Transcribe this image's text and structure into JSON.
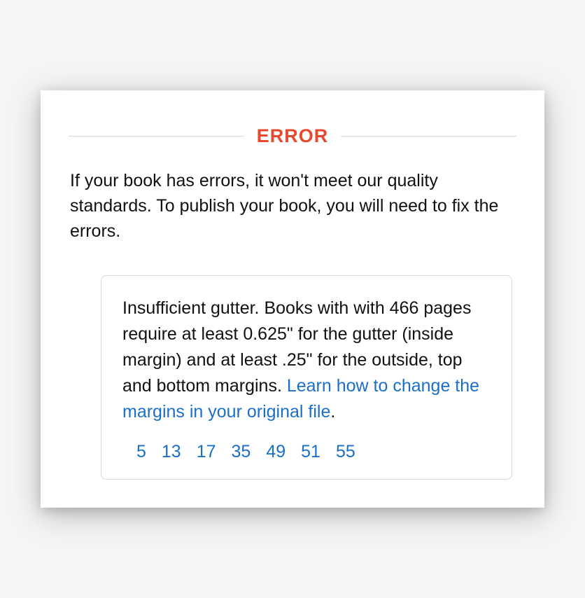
{
  "header": {
    "title": "ERROR"
  },
  "intro": "If your book has errors, it won't meet our quality standards. To publish your book, you will need to fix the errors.",
  "error_box": {
    "message": "Insufficient gutter. Books with with 466 pages require at least 0.625\" for the gutter (inside margin) and at least .25\" for the outside, top and bottom margins. ",
    "link_text": "Learn how to change the margins in your original file",
    "period": ".",
    "pages": [
      "5",
      "13",
      "17",
      "35",
      "49",
      "51",
      "55"
    ]
  },
  "colors": {
    "error_red": "#e7492e",
    "link_blue": "#1b6fc8",
    "border_gray": "#d5d9d9",
    "text_black": "#111111"
  }
}
